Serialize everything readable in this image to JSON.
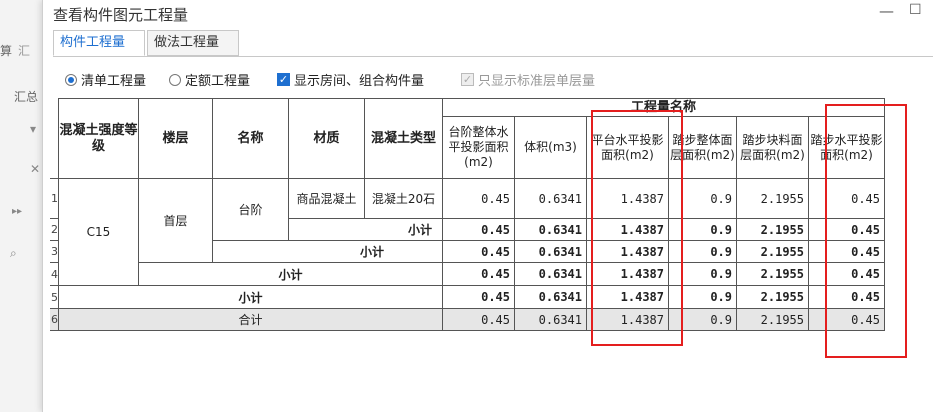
{
  "background": {
    "label_1": "算",
    "label_2": "汇",
    "label_3": "汇总"
  },
  "dialog": {
    "title": "查看构件图元工程量",
    "tabs": [
      "构件工程量",
      "做法工程量"
    ],
    "options": {
      "radio_1": "清单工程量",
      "radio_2": "定额工程量",
      "check_1": "显示房间、组合构件量",
      "check_2": "只显示标准层单层量"
    }
  },
  "table": {
    "group_header": "工程量名称",
    "headers": [
      "混凝土强度等级",
      "楼层",
      "名称",
      "材质",
      "混凝土类型"
    ],
    "qty_headers": [
      "台阶整体水平投影面积(m2)",
      "体积(m3)",
      "平台水平投影面积(m2)",
      "踏步整体面层面积(m2)",
      "踏步块料面层面积(m2)",
      "踏步水平投影面积(m2)"
    ],
    "row_numbers": [
      "1",
      "2",
      "3",
      "4",
      "5",
      "6"
    ],
    "grade": "C15",
    "floor": "首层",
    "name": "台阶",
    "material": "商品混凝土",
    "concrete_type": "混凝土20石",
    "subtotal_label": "小计",
    "total_label": "合计",
    "values": [
      "0.45",
      "0.6341",
      "1.4387",
      "0.9",
      "2.1955",
      "0.45"
    ]
  },
  "colors": {
    "accent": "#1e6fd0",
    "highlight": "#e41e1e",
    "total_row": "#e6e6e6"
  }
}
